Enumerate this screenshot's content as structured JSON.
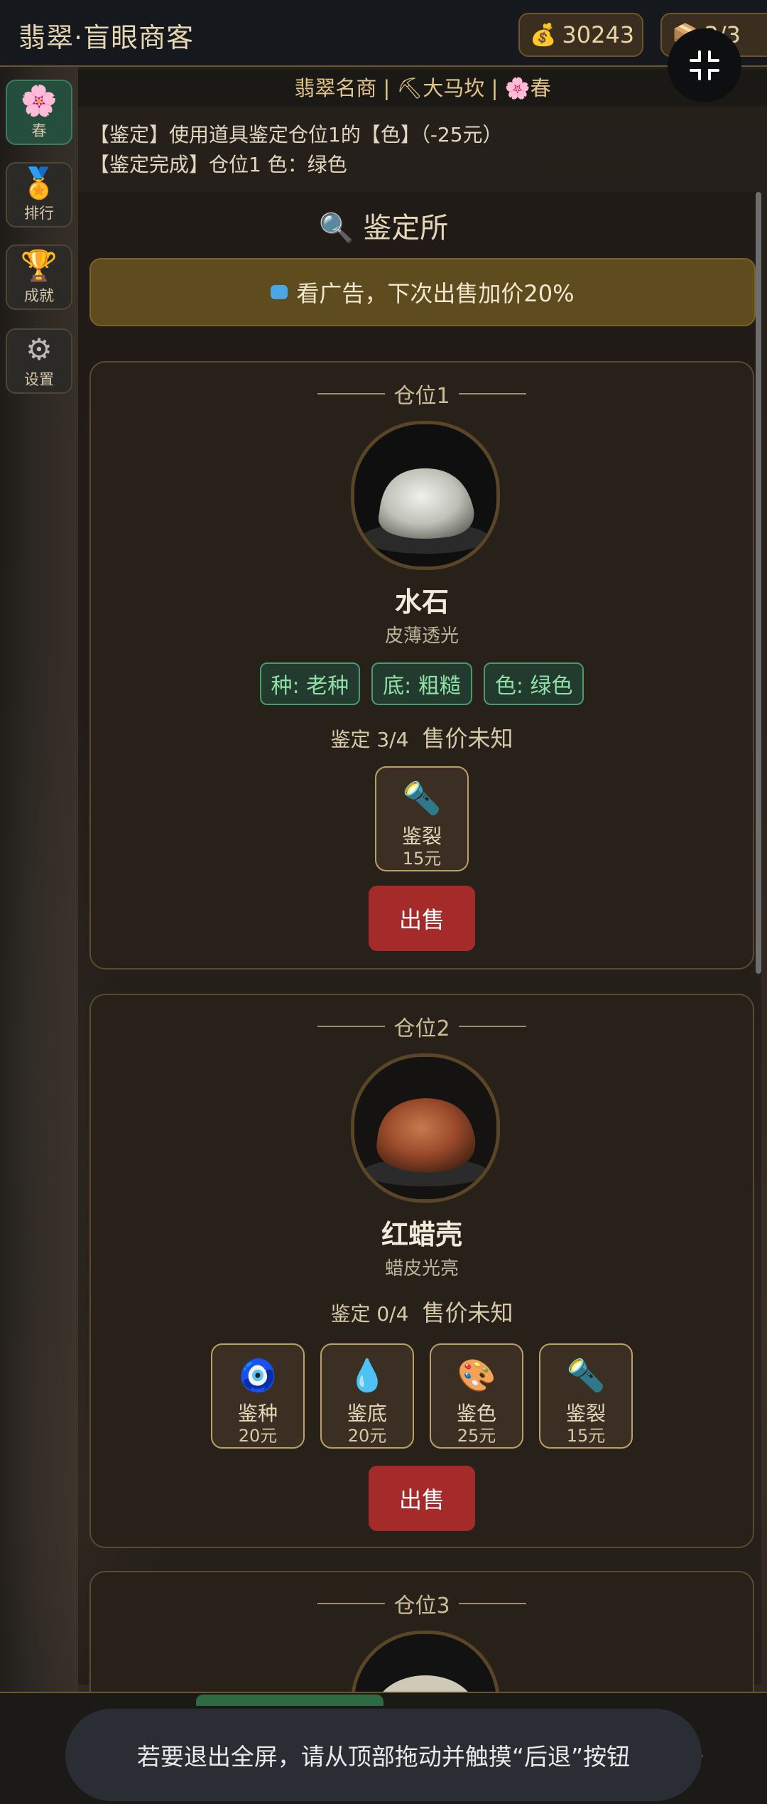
{
  "app": {
    "title": "翡翠·盲眼商客"
  },
  "topbar": {
    "coins": "30243",
    "slots": "3/3"
  },
  "nav": [
    {
      "label": "春",
      "icon": "🌸"
    },
    {
      "label": "排行",
      "icon": "🏅"
    },
    {
      "label": "成就",
      "icon": "🏆"
    },
    {
      "label": "设置",
      "icon": "⚙"
    }
  ],
  "status_line": "翡翠名商 | ⛏大马坎 | 🌸春",
  "log": [
    "【鉴定】使用道具鉴定仓位1的【色】（-25元）",
    "【鉴定完成】仓位1 色：绿色"
  ],
  "section": {
    "title": "🔍 鉴定所"
  },
  "ad": {
    "label": "看广告，下次出售加价20%"
  },
  "cards": [
    {
      "slot": "仓位1",
      "name": "水石",
      "desc": "皮薄透光",
      "tags": [
        "种: 老种",
        "底: 粗糙",
        "色: 绿色"
      ],
      "progress": "鉴定 3/4",
      "price": "售价未知",
      "tools": [
        {
          "icon": "🔦",
          "name": "鉴裂",
          "price": "15元"
        }
      ],
      "sell": "出售"
    },
    {
      "slot": "仓位2",
      "name": "红蜡壳",
      "desc": "蜡皮光亮",
      "progress": "鉴定 0/4",
      "price": "售价未知",
      "tools": [
        {
          "icon": "🧿",
          "name": "鉴种",
          "price": "20元"
        },
        {
          "icon": "💧",
          "name": "鉴底",
          "price": "20元"
        },
        {
          "icon": "🎨",
          "name": "鉴色",
          "price": "25元"
        },
        {
          "icon": "🔦",
          "name": "鉴裂",
          "price": "15元"
        }
      ],
      "sell": "出售"
    },
    {
      "slot": "仓位3"
    }
  ],
  "toast": "若要退出全屏，请从顶部拖动并触摸“后退”按钮",
  "ghost": "告",
  "colors": {
    "accent_gold": "#e3c68a",
    "sell_red": "#a52a2a",
    "tag_green": "#8fe0a6",
    "active_nav": "#264e3e"
  }
}
